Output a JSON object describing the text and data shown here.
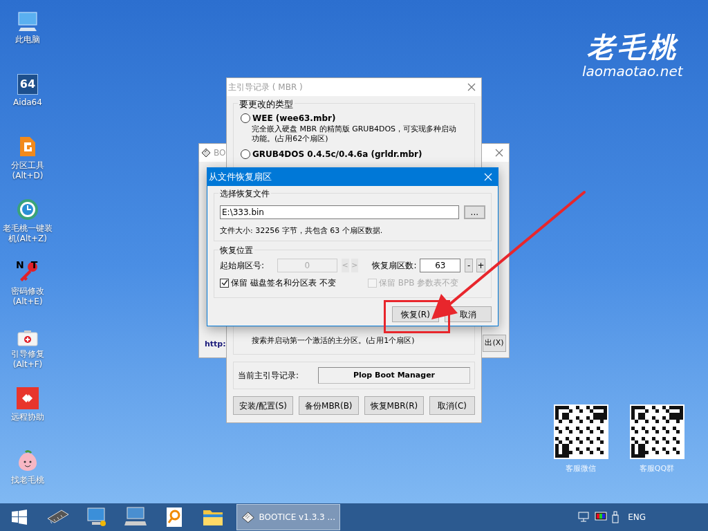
{
  "desktop_icons": [
    {
      "kind": "computer",
      "label": "此电脑"
    },
    {
      "kind": "tile",
      "label": "Aida64",
      "badge": "64"
    },
    {
      "kind": "partition",
      "label": "分区工具 (Alt+D)"
    },
    {
      "kind": "installer",
      "label": "老毛桃一键装机(Alt+Z)"
    },
    {
      "kind": "password",
      "label": "密码修改 (Alt+E)",
      "badge": "NT"
    },
    {
      "kind": "repair",
      "label": "引导修复 (Alt+F)"
    },
    {
      "kind": "remote",
      "label": "远程协助"
    },
    {
      "kind": "mascot",
      "label": "找老毛桃"
    }
  ],
  "logo": {
    "title": "老毛桃",
    "subtitle": "laomaotao.net"
  },
  "qr_codes": [
    {
      "caption": "客服微信"
    },
    {
      "caption": "客服QQ群"
    }
  ],
  "background_window": {
    "title": "BO",
    "active": false,
    "link": "http:",
    "button": "出(X)"
  },
  "mbr_window": {
    "title": "主引导记录 ( MBR )",
    "active": false,
    "group_title": "要更改的类型",
    "options": [
      {
        "label": "WEE (wee63.mbr)",
        "selected": false,
        "description": "完全嵌入硬盘 MBR 的精简版 GRUB4DOS，可实现多种启动功能。(占用62个扇区)"
      },
      {
        "label": "GRUB4DOS 0.4.5c/0.4.6a (grldr.mbr)",
        "selected": false
      }
    ],
    "visible_description": "搜索并启动第一个激活的主分区。(占用1个扇区)",
    "current_label": "当前主引导记录:",
    "current_value": "Plop Boot Manager",
    "buttons": [
      "安装/配置(S)",
      "备份MBR(B)",
      "恢复MBR(R)",
      "取消(C)"
    ]
  },
  "dialog": {
    "title": "从文件恢复扇区",
    "active": true,
    "file_group": "选择恢复文件",
    "file_path": "E:\\333.bin",
    "browse": "...",
    "info": "文件大小: 32256 字节，共包含 63 个扇区数据.",
    "position_group": "恢复位置",
    "start_label": "起始扇区号:",
    "start_value": "0",
    "start_disabled": true,
    "prev": "<",
    "next": ">",
    "count_label": "恢复扇区数:",
    "count_value": "63",
    "minus": "-",
    "plus": "+",
    "checkboxes": [
      {
        "label": "保留 磁盘签名和分区表 不变",
        "checked": true,
        "disabled": false
      },
      {
        "label": "保留 BPB 参数表不变",
        "checked": false,
        "disabled": true
      }
    ],
    "buttons": [
      {
        "label": "恢复(R)"
      },
      {
        "label": "取消"
      }
    ]
  },
  "taskbar": {
    "pinned": [
      {
        "kind": "start"
      },
      {
        "kind": "chip"
      },
      {
        "kind": "monitor-tools"
      },
      {
        "kind": "keyboard-monitor"
      },
      {
        "kind": "magnifier"
      },
      {
        "kind": "folder"
      }
    ],
    "task": {
      "label": "BOOTICE v1.3.3 ...",
      "selected": true
    },
    "tray": [
      {
        "kind": "network"
      },
      {
        "kind": "color"
      },
      {
        "kind": "usb"
      }
    ],
    "language": "ENG"
  }
}
